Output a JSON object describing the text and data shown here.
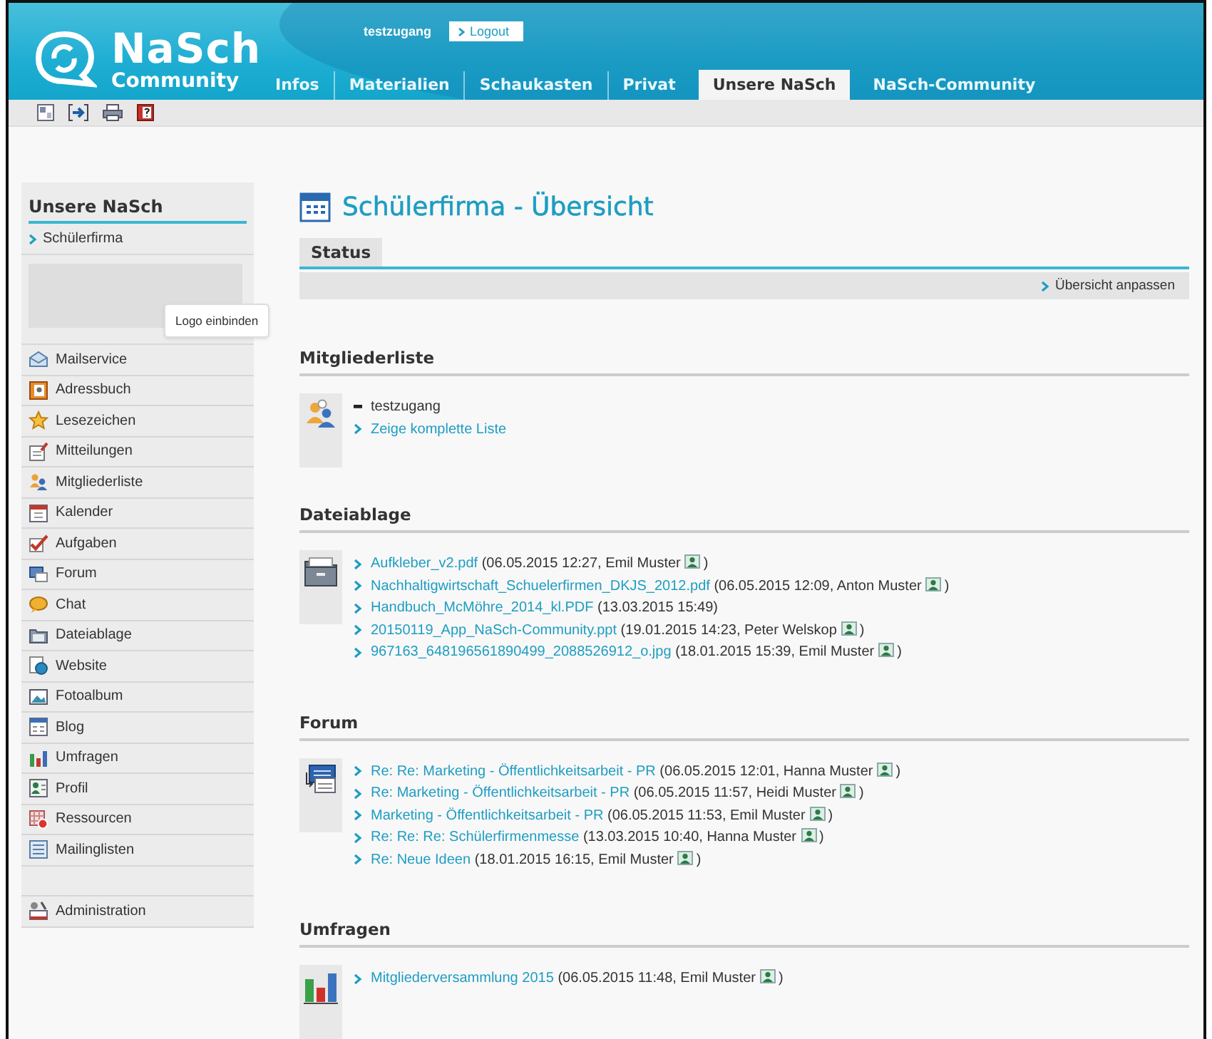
{
  "header": {
    "logo_title": "NaSch",
    "logo_subtitle": "Community",
    "user": "testzugang",
    "logout": "Logout",
    "nav": [
      {
        "label": "Infos",
        "selected": false
      },
      {
        "label": "Materialien",
        "selected": false
      },
      {
        "label": "Schaukasten",
        "selected": false
      },
      {
        "label": "Privat",
        "selected": false
      },
      {
        "label": "Unsere NaSch",
        "selected": true
      },
      {
        "label": "NaSch-Community",
        "selected": false
      }
    ]
  },
  "sidebar": {
    "title": "Unsere NaSch",
    "sub_item": "Schülerfirma",
    "logo_tooltip": "Logo einbinden",
    "items": [
      "Mailservice",
      "Adressbuch",
      "Lesezeichen",
      "Mitteilungen",
      "Mitgliederliste",
      "Kalender",
      "Aufgaben",
      "Forum",
      "Chat",
      "Dateiablage",
      "Website",
      "Fotoalbum",
      "Blog",
      "Umfragen",
      "Profil",
      "Ressourcen",
      "Mailinglisten"
    ],
    "admin_item": "Administration"
  },
  "main": {
    "title": "Schülerfirma - Übersicht",
    "tabs": [
      {
        "label": "Status",
        "selected": true
      }
    ],
    "customize_link": "Übersicht anpassen",
    "sections": [
      {
        "heading": "Mitgliederliste",
        "kind": "members",
        "entries": [
          {
            "kind": "member",
            "text": "testzugang"
          },
          {
            "kind": "link",
            "link": "Zeige komplette Liste"
          }
        ]
      },
      {
        "heading": "Dateiablage",
        "kind": "files",
        "entries": [
          {
            "kind": "link",
            "link": "Aufkleber_v2.pdf",
            "meta": "(06.05.2015 12:27, Emil Muster",
            "profile_icon": true,
            "meta_end": ")"
          },
          {
            "kind": "link",
            "link": "Nachhaltigwirtschaft_Schuelerfirmen_DKJS_2012.pdf",
            "meta": "(06.05.2015 12:09, Anton Muster",
            "profile_icon": true,
            "meta_end": ")"
          },
          {
            "kind": "link",
            "link": "Handbuch_McMöhre_2014_kl.PDF",
            "meta": "(13.03.2015 15:49)",
            "profile_icon": false
          },
          {
            "kind": "link",
            "link": "20150119_App_NaSch-Community.ppt",
            "meta": "(19.01.2015 14:23, Peter Welskop",
            "profile_icon": true,
            "meta_end": ")"
          },
          {
            "kind": "link",
            "link": "967163_648196561890499_2088526912_o.jpg",
            "meta": "(18.01.2015 15:39, Emil Muster",
            "profile_icon": true,
            "meta_end": ")"
          }
        ]
      },
      {
        "heading": "Forum",
        "kind": "forum",
        "entries": [
          {
            "kind": "link",
            "link": "Re: Re: Marketing - Öffentlichkeitsarbeit - PR",
            "meta": "(06.05.2015 12:01, Hanna Muster",
            "profile_icon": true,
            "meta_end": ")"
          },
          {
            "kind": "link",
            "link": "Re: Marketing - Öffentlichkeitsarbeit - PR",
            "meta": "(06.05.2015 11:57, Heidi Muster",
            "profile_icon": true,
            "meta_end": ")"
          },
          {
            "kind": "link",
            "link": "Marketing - Öffentlichkeitsarbeit - PR",
            "meta": "(06.05.2015 11:53, Emil Muster",
            "profile_icon": true,
            "meta_end": ")"
          },
          {
            "kind": "link",
            "link": "Re: Re: Re: Schülerfirmenmesse",
            "meta": "(13.03.2015 10:40, Hanna Muster",
            "profile_icon": true,
            "meta_end": ")"
          },
          {
            "kind": "link",
            "link": "Re: Neue Ideen",
            "meta": "(18.01.2015 16:15, Emil Muster",
            "profile_icon": true,
            "meta_end": ")"
          }
        ]
      },
      {
        "heading": "Umfragen",
        "kind": "polls",
        "entries": [
          {
            "kind": "link",
            "link": "Mitgliederversammlung 2015",
            "meta": "(06.05.2015 11:48, Emil Muster",
            "profile_icon": true,
            "meta_end": ")"
          }
        ]
      }
    ]
  }
}
